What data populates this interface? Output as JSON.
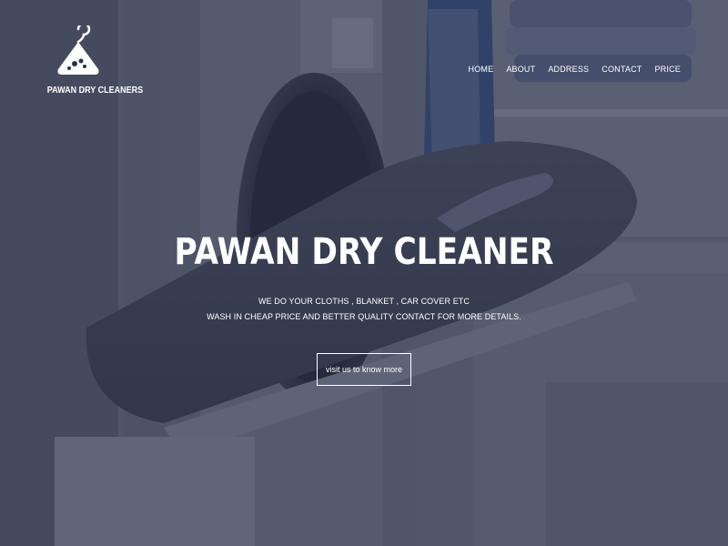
{
  "brand": {
    "name": "PAWAN DRY CLEANERS",
    "logo_icon": "hanger-icon"
  },
  "nav": {
    "items": [
      {
        "label": "HOME"
      },
      {
        "label": "ABOUT"
      },
      {
        "label": "ADDRESS"
      },
      {
        "label": "CONTACT"
      },
      {
        "label": "PRICE"
      }
    ]
  },
  "hero": {
    "title": "PAWAN DRY CLEANER",
    "line1": "WE DO YOUR CLOTHS , BLANKET , CAR COVER ETC",
    "line2": "WASH IN CHEAP PRICE AND BETTER QUALITY CONTACT FOR MORE DETAILS.",
    "cta_label": "visit us to know more",
    "background": "laundry room with washing machine, iron and ironing board"
  },
  "colors": {
    "overlay": "#262c42",
    "text": "#ffffff"
  }
}
